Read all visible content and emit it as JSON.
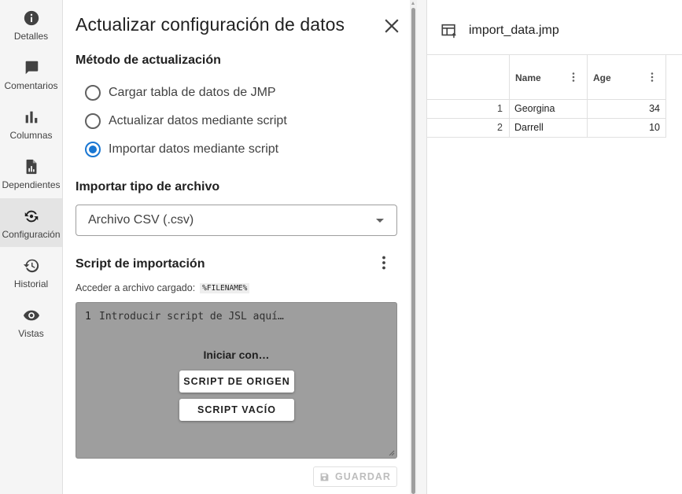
{
  "rail": {
    "items": [
      {
        "label": "Detalles",
        "icon": "info-icon"
      },
      {
        "label": "Comentarios",
        "icon": "comment-icon"
      },
      {
        "label": "Columnas",
        "icon": "bar-chart-icon"
      },
      {
        "label": "Dependientes",
        "icon": "document-chart-icon"
      },
      {
        "label": "Configuración",
        "icon": "sync-settings-icon",
        "active": true
      },
      {
        "label": "Historial",
        "icon": "history-icon"
      },
      {
        "label": "Vistas",
        "icon": "eye-icon"
      }
    ]
  },
  "panel": {
    "title": "Actualizar configuración de datos",
    "method_label": "Método de actualización",
    "methods": [
      {
        "label": "Cargar tabla de datos de JMP",
        "checked": false
      },
      {
        "label": "Actualizar datos mediante script",
        "checked": false
      },
      {
        "label": "Importar datos mediante script",
        "checked": true
      }
    ],
    "file_type_label": "Importar tipo de archivo",
    "file_type_value": "Archivo CSV (.csv)",
    "script_label": "Script de importación",
    "hint_text": "Acceder a archivo cargado:",
    "hint_code": "%FILENAME%",
    "editor": {
      "line_number": "1",
      "placeholder": "Introducir script de JSL aquí…",
      "start_with": "Iniciar con…",
      "source_button": "SCRIPT DE ORIGEN",
      "empty_button": "SCRIPT VACÍO"
    },
    "save_button": "GUARDAR"
  },
  "table": {
    "name": "import_data.jmp",
    "columns": [
      "Name",
      "Age"
    ],
    "rows": [
      {
        "index": "1",
        "name": "Georgina",
        "age": "34"
      },
      {
        "index": "2",
        "name": "Darrell",
        "age": "10"
      }
    ]
  },
  "colors": {
    "accent": "#1976d2",
    "editor_bg": "#9e9e9e",
    "rail_bg": "#f5f5f5"
  }
}
